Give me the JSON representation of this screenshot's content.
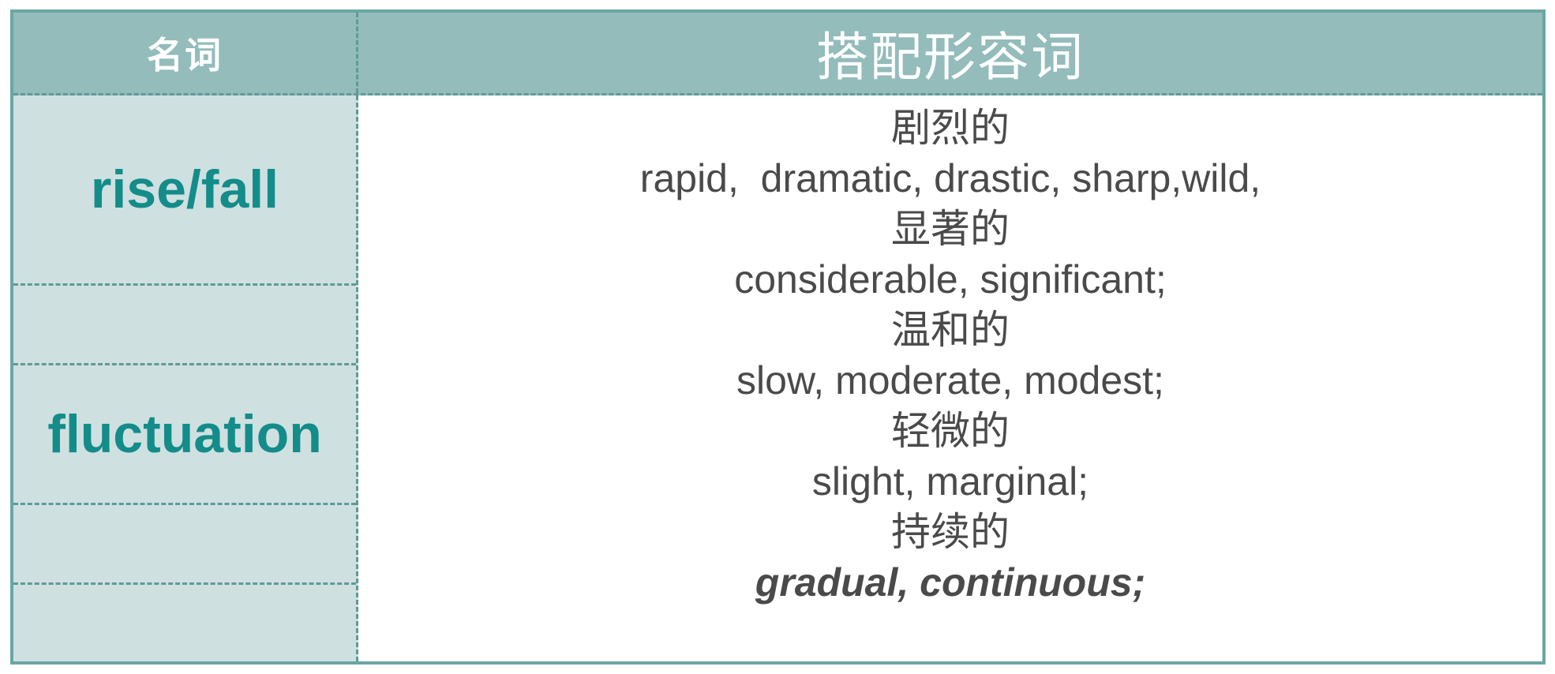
{
  "header": {
    "noun_label": "名词",
    "adjectives_label": "搭配形容词"
  },
  "nouns": [
    "rise/fall",
    "fluctuation"
  ],
  "adjectives": [
    {
      "text": "剧烈的"
    },
    {
      "text": "rapid,  dramatic, drastic, sharp,wild,"
    },
    {
      "text": "显著的"
    },
    {
      "text": "considerable, significant;"
    },
    {
      "text": "温和的"
    },
    {
      "text": "slow, moderate, modest;"
    },
    {
      "text": "轻微的"
    },
    {
      "text": "slight, marginal;"
    },
    {
      "text": "持续的"
    },
    {
      "text": "gradual, continuous;"
    }
  ],
  "colors": {
    "header_bg": "#93bcbb",
    "left_col_bg": "#cfe0e0",
    "border": "#6aa6a4",
    "noun_text": "#138c8a",
    "body_text": "#4a4a4a"
  }
}
